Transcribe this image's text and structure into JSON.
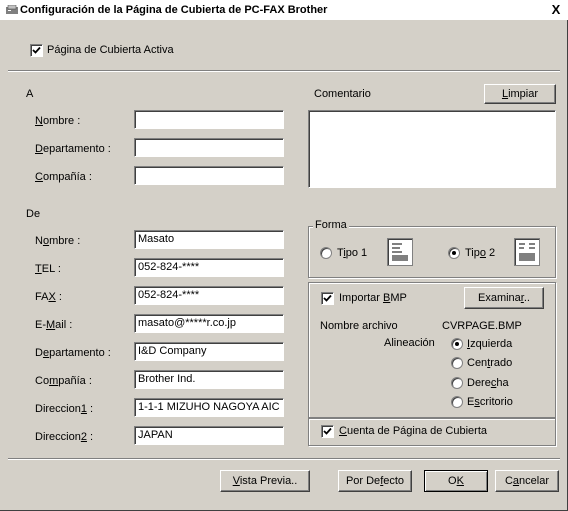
{
  "window": {
    "title": "Configuración de la Página de Cubierta de PC-FAX Brother",
    "close_glyph": "X"
  },
  "cover_active": {
    "label": "Página de Cubierta Activa",
    "checked": true
  },
  "to_section": {
    "heading": "A",
    "fields": [
      {
        "label": "Nombre :",
        "value": ""
      },
      {
        "label": "Departamento :",
        "value": ""
      },
      {
        "label": "Compañía :",
        "value": ""
      }
    ]
  },
  "comment": {
    "label": "Comentario",
    "clear_button": "Limpiar",
    "value": ""
  },
  "from_section": {
    "heading": "De",
    "fields": [
      {
        "label": "Nombre :",
        "value": "Masato"
      },
      {
        "label": "TEL :",
        "value": "052-824-****"
      },
      {
        "label": "FAX :",
        "value": "052-824-****"
      },
      {
        "label": "E-Mail :",
        "value": "masato@*****r.co.jp"
      },
      {
        "label": "Departamento :",
        "value": "I&D Company"
      },
      {
        "label": "Compañía :",
        "value": "Brother Ind."
      },
      {
        "label": "Direccion1 :",
        "value": "1-1-1 MIZUHO NAGOYA AIC"
      },
      {
        "label": "Direccion2 :",
        "value": "JAPAN"
      }
    ]
  },
  "form_group": {
    "title": "Forma",
    "type1": {
      "label": "Tipo 1",
      "selected": false
    },
    "type2": {
      "label": "Tipo 2",
      "selected": true
    }
  },
  "bmp": {
    "import_label": "Importar BMP",
    "import_checked": true,
    "browse_button": "Examinar..",
    "filename_label": "Nombre archivo",
    "filename_value": "CVRPAGE.BMP",
    "alignment_label": "Alineación",
    "alignment_options": [
      "Izquierda",
      "Centrado",
      "Derecha",
      "Escritorio"
    ],
    "alignment_selected": 0
  },
  "count_pages": {
    "label": "Cuenta de Página de Cubierta",
    "checked": true
  },
  "buttons": {
    "preview": "Vista Previa..",
    "default": "Por Defecto",
    "ok": "OK",
    "cancel": "Cancelar"
  }
}
